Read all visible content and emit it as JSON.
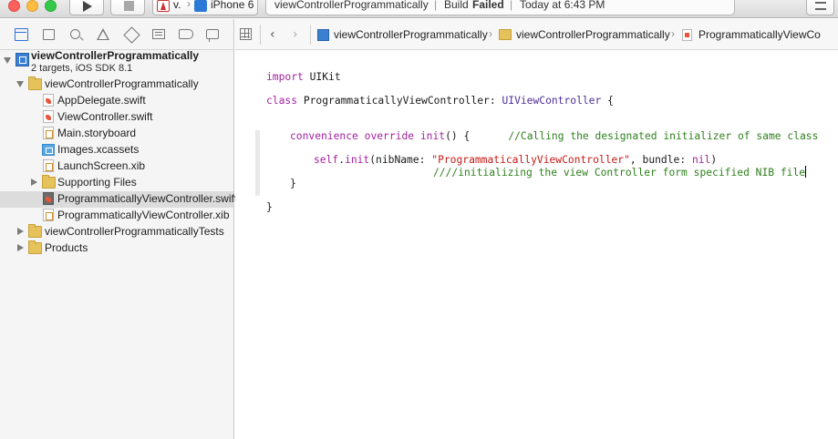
{
  "toolbar": {
    "scheme_name": "v.",
    "scheme_sep": "›",
    "device_name": "iPhone 6",
    "activity_project": "viewControllerProgrammatically",
    "activity_sep1": "|",
    "activity_build": "Build",
    "activity_status": "Failed",
    "activity_sep2": "|",
    "activity_time": "Today at 6:43 PM"
  },
  "navigator": {
    "project": {
      "name": "viewControllerProgrammatically",
      "subtitle": "2 targets, iOS SDK 8.1"
    },
    "items": [
      {
        "label": "viewControllerProgrammatically",
        "icon": "folder-icon"
      },
      {
        "label": "AppDelegate.swift",
        "icon": "swift-file-icon"
      },
      {
        "label": "ViewController.swift",
        "icon": "swift-file-icon"
      },
      {
        "label": "Main.storyboard",
        "icon": "storyboard-file-icon"
      },
      {
        "label": "Images.xcassets",
        "icon": "asset-catalog-icon"
      },
      {
        "label": "LaunchScreen.xib",
        "icon": "xib-file-icon"
      },
      {
        "label": "Supporting Files",
        "icon": "folder-icon"
      },
      {
        "label": "ProgrammaticallyViewController.swift",
        "icon": "swift-file-icon",
        "selected": true
      },
      {
        "label": "ProgrammaticallyViewController.xib",
        "icon": "xib-file-icon"
      },
      {
        "label": "viewControllerProgrammaticallyTests",
        "icon": "folder-icon"
      },
      {
        "label": "Products",
        "icon": "folder-icon"
      }
    ]
  },
  "jumpbar": {
    "back": "‹",
    "forward": "›",
    "crumbs": [
      "viewControllerProgrammatically",
      "viewControllerProgrammatically",
      "ProgrammaticallyViewCo"
    ],
    "sep": "›"
  },
  "code": {
    "l1_kw": "import",
    "l1_rest": " UIKit",
    "l2_kw": "class",
    "l2_name": " ProgrammaticallyViewController: ",
    "l2_super": "UIViewController",
    "l2_end": " {",
    "l3_kw1": "convenience",
    "l3_kw2": "override",
    "l3_fn": "init",
    "l3_rest": "() {",
    "l3_comment": "//Calling the designated initializer of same class",
    "l4_self": "self",
    "l4_dot": ".",
    "l4_init": "init",
    "l4_args1": "(nibName: ",
    "l4_str": "\"ProgrammaticallyViewController\"",
    "l4_args2": ", bundle: ",
    "l4_nil": "nil",
    "l4_end": ")",
    "l5_comment": "////initializing the view Controller form specified NIB file",
    "l6": "}",
    "l7": "}"
  }
}
